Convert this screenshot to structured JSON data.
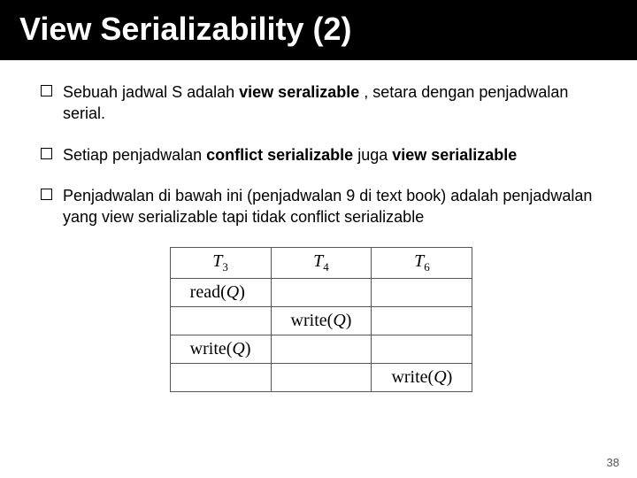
{
  "title": "View Serializability (2)",
  "bullets": [
    {
      "pre": "Sebuah jadwal S adalah ",
      "bold": "view seralizable",
      "post": " , setara dengan penjadwalan serial."
    },
    {
      "pre": "Setiap penjadwalan ",
      "bold": "conflict serializable",
      "post": " juga ",
      "bold2": "view serializable"
    },
    {
      "pre": "Penjadwalan di bawah ini (penjadwalan 9 di text book) adalah penjadwalan yang view serializable tapi tidak conflict serializable",
      "bold": "",
      "post": ""
    }
  ],
  "table": {
    "headers": [
      "T3",
      "T4",
      "T6"
    ],
    "rows": [
      [
        "read(Q)",
        "",
        ""
      ],
      [
        "",
        "write(Q)",
        ""
      ],
      [
        "write(Q)",
        "",
        ""
      ],
      [
        "",
        "",
        "write(Q)"
      ]
    ]
  },
  "page": "38"
}
